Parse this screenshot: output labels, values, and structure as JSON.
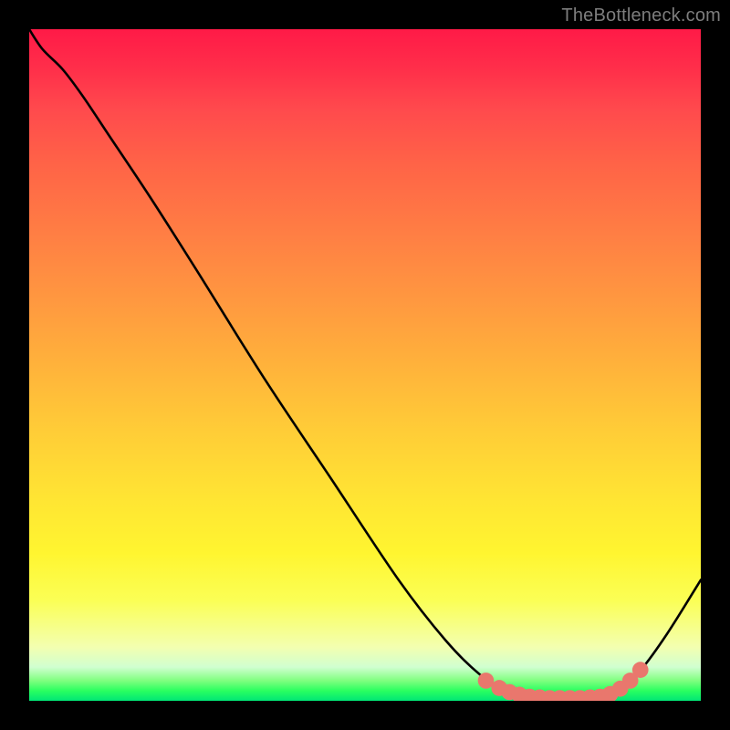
{
  "attribution": "TheBottleneck.com",
  "chart_data": {
    "type": "line",
    "title": "",
    "xlabel": "",
    "ylabel": "",
    "xlim": [
      0,
      100
    ],
    "ylim": [
      0,
      100
    ],
    "curve": {
      "name": "bottleneck-curve",
      "color": "#000000",
      "points": [
        {
          "x": 0,
          "y": 100
        },
        {
          "x": 2,
          "y": 97
        },
        {
          "x": 5,
          "y": 94
        },
        {
          "x": 8,
          "y": 90
        },
        {
          "x": 12,
          "y": 84
        },
        {
          "x": 18,
          "y": 75
        },
        {
          "x": 25,
          "y": 64
        },
        {
          "x": 35,
          "y": 48
        },
        {
          "x": 45,
          "y": 33
        },
        {
          "x": 55,
          "y": 18
        },
        {
          "x": 62,
          "y": 9
        },
        {
          "x": 67,
          "y": 4
        },
        {
          "x": 71,
          "y": 1.5
        },
        {
          "x": 75,
          "y": 0.5
        },
        {
          "x": 80,
          "y": 0.3
        },
        {
          "x": 85,
          "y": 0.5
        },
        {
          "x": 88,
          "y": 1.8
        },
        {
          "x": 91,
          "y": 4.5
        },
        {
          "x": 95,
          "y": 10
        },
        {
          "x": 100,
          "y": 18
        }
      ]
    },
    "markers": {
      "name": "optimal-zone-dots",
      "color": "#e9776d",
      "radius": 1.2,
      "points": [
        {
          "x": 68,
          "y": 3.0
        },
        {
          "x": 70,
          "y": 1.9
        },
        {
          "x": 71.5,
          "y": 1.3
        },
        {
          "x": 73,
          "y": 0.9
        },
        {
          "x": 74.5,
          "y": 0.6
        },
        {
          "x": 76,
          "y": 0.5
        },
        {
          "x": 77.5,
          "y": 0.4
        },
        {
          "x": 79,
          "y": 0.4
        },
        {
          "x": 80.5,
          "y": 0.4
        },
        {
          "x": 82,
          "y": 0.4
        },
        {
          "x": 83.5,
          "y": 0.5
        },
        {
          "x": 85,
          "y": 0.6
        },
        {
          "x": 86.5,
          "y": 1.0
        },
        {
          "x": 88,
          "y": 1.8
        },
        {
          "x": 89.5,
          "y": 3.0
        },
        {
          "x": 91,
          "y": 4.6
        }
      ]
    }
  }
}
